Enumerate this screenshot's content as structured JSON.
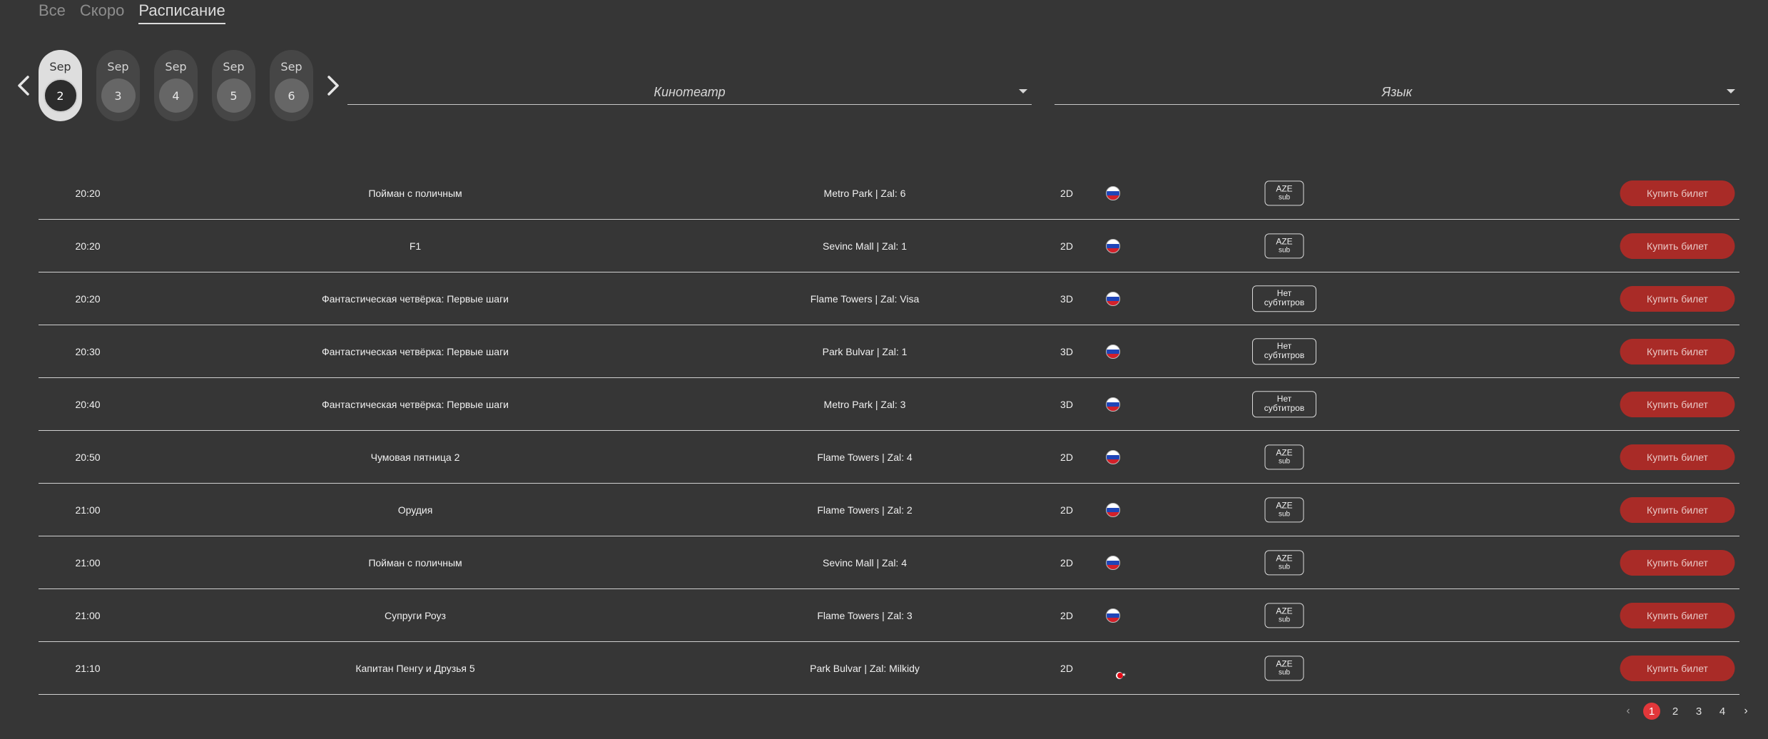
{
  "tabs": [
    {
      "label": "Все",
      "active": false
    },
    {
      "label": "Скоро",
      "active": false
    },
    {
      "label": "Расписание",
      "active": true
    }
  ],
  "dates": [
    {
      "month": "Sep",
      "day": "2",
      "selected": true
    },
    {
      "month": "Sep",
      "day": "3",
      "selected": false
    },
    {
      "month": "Sep",
      "day": "4",
      "selected": false
    },
    {
      "month": "Sep",
      "day": "5",
      "selected": false
    },
    {
      "month": "Sep",
      "day": "6",
      "selected": false
    }
  ],
  "filters": {
    "cinema_label": "Кинотеатр",
    "language_label": "Язык"
  },
  "schedule": [
    {
      "time": "20:20",
      "title": "Пойман с поличным",
      "cinema": "Metro Park | Zal: 6",
      "format": "2D",
      "flag": "ru",
      "sub": [
        "AZE",
        "sub"
      ],
      "button": "Купить билет"
    },
    {
      "time": "20:20",
      "title": "F1",
      "cinema": "Sevinc Mall | Zal: 1",
      "format": "2D",
      "flag": "ru",
      "sub": [
        "AZE",
        "sub"
      ],
      "button": "Купить билет"
    },
    {
      "time": "20:20",
      "title": "Фантастическая четвёрка: Первые шаги",
      "cinema": "Flame Towers | Zal: Visa",
      "format": "3D",
      "flag": "ru",
      "sub": [
        "Нет",
        "субтитров"
      ],
      "button": "Купить билет"
    },
    {
      "time": "20:30",
      "title": "Фантастическая четвёрка: Первые шаги",
      "cinema": "Park Bulvar | Zal: 1",
      "format": "3D",
      "flag": "ru",
      "sub": [
        "Нет",
        "субтитров"
      ],
      "button": "Купить билет"
    },
    {
      "time": "20:40",
      "title": "Фантастическая четвёрка: Первые шаги",
      "cinema": "Metro Park | Zal: 3",
      "format": "3D",
      "flag": "ru",
      "sub": [
        "Нет",
        "субтитров"
      ],
      "button": "Купить билет"
    },
    {
      "time": "20:50",
      "title": "Чумовая пятница 2",
      "cinema": "Flame Towers | Zal: 4",
      "format": "2D",
      "flag": "ru",
      "sub": [
        "AZE",
        "sub"
      ],
      "button": "Купить билет"
    },
    {
      "time": "21:00",
      "title": "Орудия",
      "cinema": "Flame Towers | Zal: 2",
      "format": "2D",
      "flag": "ru",
      "sub": [
        "AZE",
        "sub"
      ],
      "button": "Купить билет"
    },
    {
      "time": "21:00",
      "title": "Пойман с поличным",
      "cinema": "Sevinc Mall | Zal: 4",
      "format": "2D",
      "flag": "ru",
      "sub": [
        "AZE",
        "sub"
      ],
      "button": "Купить билет"
    },
    {
      "time": "21:00",
      "title": "Супруги Роуз",
      "cinema": "Flame Towers | Zal: 3",
      "format": "2D",
      "flag": "ru",
      "sub": [
        "AZE",
        "sub"
      ],
      "button": "Купить билет"
    },
    {
      "time": "21:10",
      "title": "Капитан Пенгу и Друзья 5",
      "cinema": "Park Bulvar | Zal: Milkidy",
      "format": "2D",
      "flag": "tr",
      "sub": [
        "AZE",
        "sub"
      ],
      "button": "Купить билет"
    }
  ],
  "pagination": {
    "pages": [
      "1",
      "2",
      "3",
      "4"
    ],
    "current": "1",
    "prev_icon": "chevron-left-icon",
    "next_icon": "chevron-right-icon"
  },
  "colors": {
    "background": "#363636",
    "buy_button": "#a92b27",
    "active_page": "#e2373a"
  }
}
